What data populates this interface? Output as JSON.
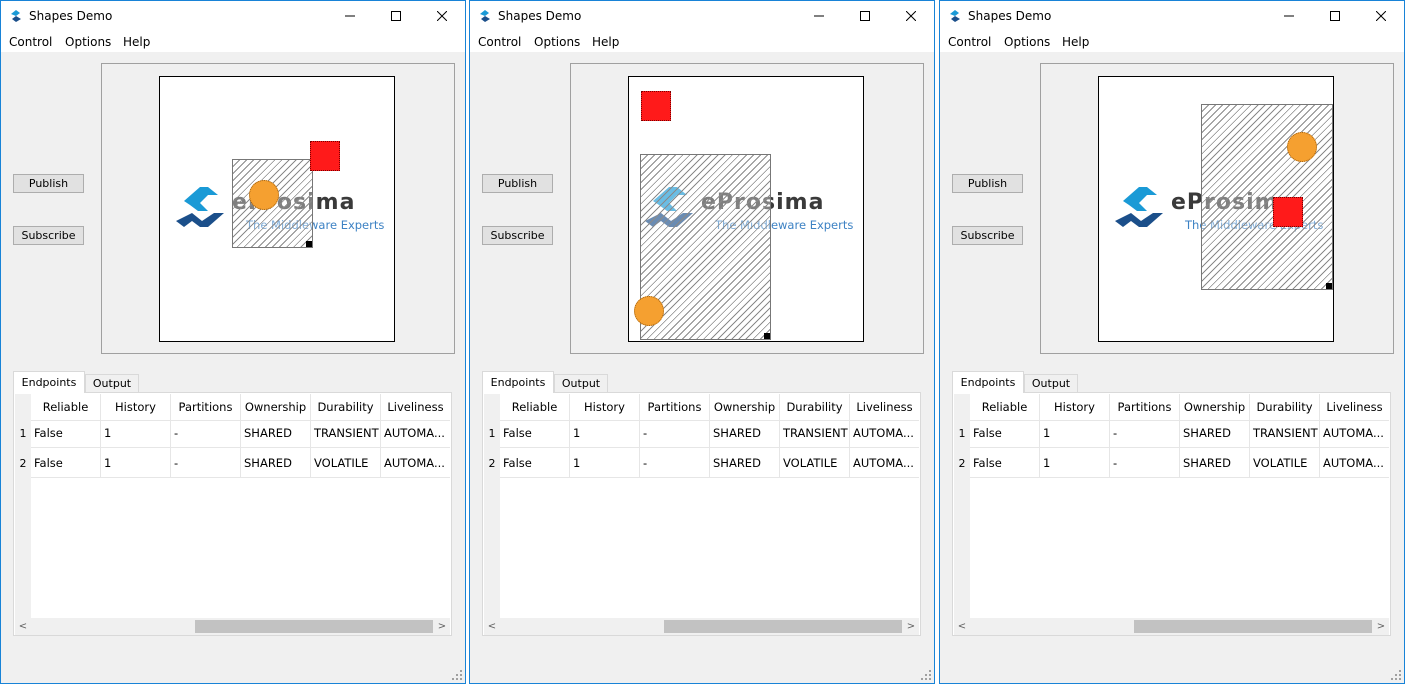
{
  "app": {
    "title": "Shapes Demo"
  },
  "menu": {
    "control": "Control",
    "options": "Options",
    "help": "Help"
  },
  "buttons": {
    "publish": "Publish",
    "subscribe": "Subscribe"
  },
  "logo": {
    "brand": "eProsima",
    "tagline": "The Middleware Experts",
    "brand_color": "#3a3a3a",
    "tagline_color": "#3d82c4"
  },
  "colors": {
    "square": "#ff1a1a",
    "circle": "#f5a030",
    "window_border": "#1883d7"
  },
  "tabs": {
    "endpoints": "Endpoints",
    "output": "Output"
  },
  "table": {
    "columns": [
      "Reliable",
      "History",
      "Partitions",
      "Ownership",
      "Durability",
      "Liveliness"
    ],
    "rows": [
      {
        "num": "1",
        "cells": [
          "False",
          "1",
          "-",
          "SHARED",
          "TRANSIENT",
          "AUTOMA..."
        ]
      },
      {
        "num": "2",
        "cells": [
          "False",
          "1",
          "-",
          "SHARED",
          "VOLATILE",
          "AUTOMA..."
        ]
      }
    ]
  },
  "scroll_arrows": {
    "left": "<",
    "right": ">"
  }
}
